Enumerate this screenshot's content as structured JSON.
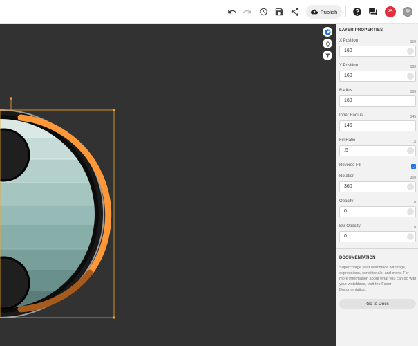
{
  "toolbar": {
    "icons": [
      "undo-icon",
      "redo-icon",
      "history-icon",
      "save-icon",
      "share-icon",
      "help-icon",
      "chat-icon",
      "notifications-icon"
    ],
    "publish_label": "Publish",
    "notification_count": "25"
  },
  "canvas": {
    "background": "#323232",
    "accent": "#ff9838",
    "selection_color": "#f5a623"
  },
  "panel": {
    "title": "LAYER PROPERTIES",
    "properties": [
      {
        "label": "X Position",
        "max": "160",
        "value": "160"
      },
      {
        "label": "Y Position",
        "max": "160",
        "value": "160"
      },
      {
        "label": "Radius",
        "max": "160",
        "value": "160"
      },
      {
        "label": "Inner Radius",
        "max": "145",
        "value": "145"
      },
      {
        "label": "Fill Ratio",
        "max": ".5",
        "value": ".5"
      },
      {
        "label": "Rotation",
        "max": "360",
        "value": "360"
      },
      {
        "label": "Opacity",
        "max": "0",
        "value": "0"
      },
      {
        "label": "BG Opacity",
        "max": "0",
        "value": "0"
      }
    ],
    "reverse_fill_label": "Reverse Fill",
    "reverse_fill_checked": true
  },
  "docs": {
    "title": "DOCUMENTATION",
    "text": "Supercharge your watchface with tags, expressions, conditionals, and more. For more information about what you can do with your watchface, visit the Facer Documentation:",
    "button_label": "Go to Docs"
  }
}
